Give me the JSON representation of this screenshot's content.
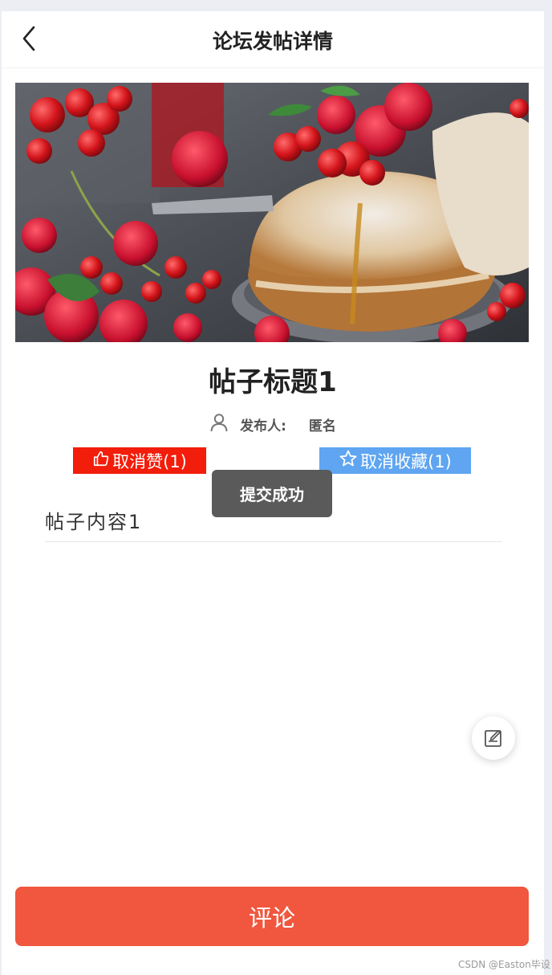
{
  "header": {
    "title": "论坛发帖详情"
  },
  "post": {
    "title": "帖子标题1",
    "author_label": "发布人:",
    "author_name": "匿名",
    "content": "帖子内容1"
  },
  "actions": {
    "like_label": "取消赞(1)",
    "favorite_label": "取消收藏(1)"
  },
  "toast": {
    "message": "提交成功"
  },
  "footer": {
    "comment_label": "评论"
  },
  "watermark": "CSDN @Easton毕设",
  "colors": {
    "like_bg": "#f21d0a",
    "favorite_bg": "#5fa5f1",
    "comment_bg": "#f0573e",
    "toast_bg": "#5a5a5a"
  },
  "icons": {
    "back": "chevron-left-icon",
    "user": "user-icon",
    "like": "thumbs-up-icon",
    "favorite": "star-icon",
    "edit": "edit-note-icon"
  }
}
